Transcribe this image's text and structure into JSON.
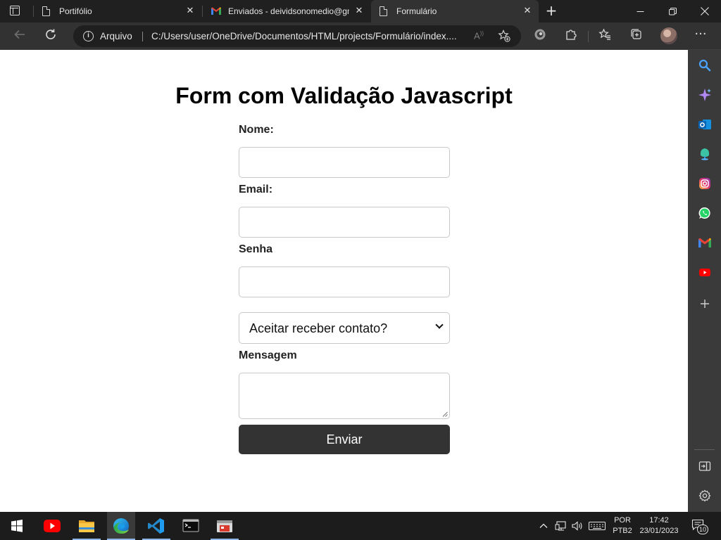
{
  "browser": {
    "tabs": [
      {
        "title": "Portifólio",
        "favicon": "page-icon",
        "active": false
      },
      {
        "title": "Enviados - deividsonomedio@gm",
        "favicon": "gmail-icon",
        "active": false
      },
      {
        "title": "Formulário",
        "favicon": "page-icon",
        "active": true
      }
    ],
    "address": {
      "scheme_label": "Arquivo",
      "url": "C:/Users/user/OneDrive/Documentos/HTML/projects/Formulário/index...."
    },
    "read_aloud_label": "A⁾",
    "window_buttons": [
      "minimize-icon",
      "restore-icon",
      "close-icon"
    ]
  },
  "page": {
    "title": "Form com Validação Javascript",
    "fields": {
      "name_label": "Nome:",
      "email_label": "Email:",
      "password_label": "Senha",
      "contact_select_value": "Aceitar receber contato?",
      "message_label": "Mensagem"
    },
    "submit_label": "Enviar"
  },
  "sidebar": {
    "items": [
      "search-icon",
      "copilot-icon",
      "outlook-icon",
      "tree-icon",
      "instagram-icon",
      "whatsapp-icon",
      "gmail-icon",
      "youtube-icon",
      "add-icon"
    ],
    "bottom": [
      "panel-toggle-icon",
      "settings-icon"
    ]
  },
  "taskbar": {
    "apps": [
      "start-icon",
      "youtube-icon",
      "file-explorer-icon",
      "edge-icon",
      "vscode-icon",
      "terminal-icon",
      "app-icon"
    ],
    "language": "POR",
    "layout": "PTB2",
    "time": "17:42",
    "date": "23/01/2023",
    "notifications": "10"
  },
  "colors": {
    "tabstrip": "#202020",
    "toolbar": "#323232",
    "submit": "#333333",
    "taskbar": "#1c1c1c",
    "edge_blue": "#1a9ce8"
  }
}
